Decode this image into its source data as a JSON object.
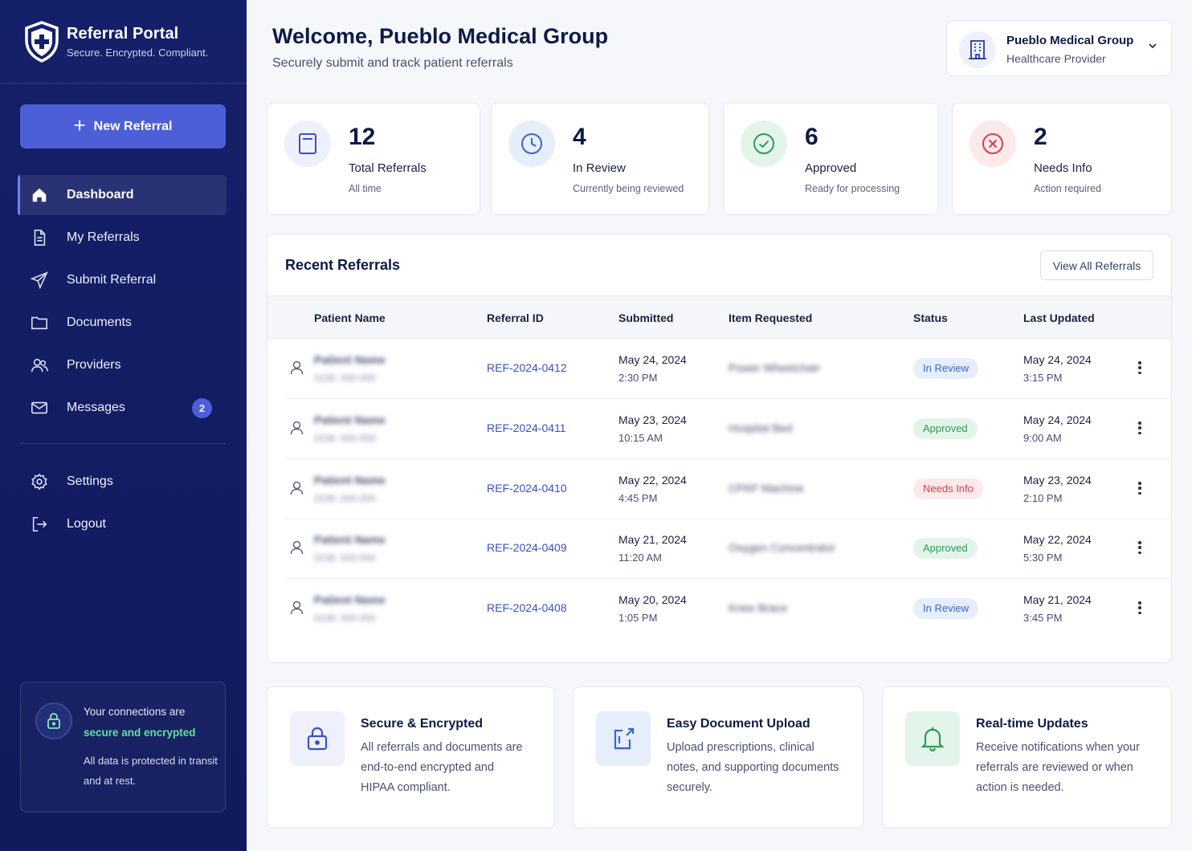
{
  "brand": {
    "title": "Referral Portal",
    "subtitle": "Secure. Encrypted. Compliant."
  },
  "sidebar": {
    "new_button": "New Referral",
    "items": [
      {
        "label": "Dashboard",
        "icon": "home-icon",
        "active": true
      },
      {
        "label": "My Referrals",
        "icon": "document-icon"
      },
      {
        "label": "Submit Referral",
        "icon": "send-icon"
      },
      {
        "label": "Documents",
        "icon": "folder-icon"
      },
      {
        "label": "Providers",
        "icon": "users-icon"
      },
      {
        "label": "Messages",
        "icon": "mail-icon",
        "badge": "2"
      }
    ],
    "secondary": [
      {
        "label": "Settings",
        "icon": "gear-icon"
      },
      {
        "label": "Logout",
        "icon": "logout-icon"
      }
    ],
    "security": {
      "line1": "Your connections are",
      "line2": "secure and encrypted",
      "note": "All data is protected in transit and at rest."
    }
  },
  "header": {
    "welcome": "Welcome, Pueblo Medical Group",
    "subtitle": "Securely submit and track patient referrals",
    "org_name": "Pueblo Medical Group",
    "org_role": "Healthcare Provider"
  },
  "stats": [
    {
      "value": "12",
      "label": "Total Referrals",
      "sub": "All time",
      "icon": "document-icon",
      "color": "#3a4fc4",
      "bg": "#eef0fb"
    },
    {
      "value": "4",
      "label": "In Review",
      "sub": "Currently being reviewed",
      "icon": "clock-icon",
      "color": "#3a64c8",
      "bg": "#e6eefb"
    },
    {
      "value": "6",
      "label": "Approved",
      "sub": "Ready for processing",
      "icon": "check-circle-icon",
      "color": "#2f9a57",
      "bg": "#e3f5ea"
    },
    {
      "value": "2",
      "label": "Needs Info",
      "sub": "Action required",
      "icon": "x-circle-icon",
      "color": "#d0434f",
      "bg": "#fde8ea"
    }
  ],
  "recent": {
    "title": "Recent Referrals",
    "view_all": "View All Referrals",
    "columns": [
      "Patient Name",
      "Referral ID",
      "Submitted",
      "Item Requested",
      "Status",
      "Last Updated"
    ],
    "rows": [
      {
        "name": "Patient Name",
        "dob": "DOB: 000-000",
        "id": "REF-2024-0412",
        "submitted_date": "May 24, 2024",
        "submitted_time": "2:30 PM",
        "item": "Power Wheelchair",
        "status": "In Review",
        "status_kind": "review",
        "updated_date": "May 24, 2024",
        "updated_time": "3:15 PM"
      },
      {
        "name": "Patient Name",
        "dob": "DOB: 000-000",
        "id": "REF-2024-0411",
        "submitted_date": "May 23, 2024",
        "submitted_time": "10:15 AM",
        "item": "Hospital Bed",
        "status": "Approved",
        "status_kind": "approved",
        "updated_date": "May 24, 2024",
        "updated_time": "9:00 AM"
      },
      {
        "name": "Patient Name",
        "dob": "DOB: 000-000",
        "id": "REF-2024-0410",
        "submitted_date": "May 22, 2024",
        "submitted_time": "4:45 PM",
        "item": "CPAP Machine",
        "status": "Needs Info",
        "status_kind": "needs",
        "updated_date": "May 23, 2024",
        "updated_time": "2:10 PM"
      },
      {
        "name": "Patient Name",
        "dob": "DOB: 000-000",
        "id": "REF-2024-0409",
        "submitted_date": "May 21, 2024",
        "submitted_time": "11:20 AM",
        "item": "Oxygen Concentrator",
        "status": "Approved",
        "status_kind": "approved",
        "updated_date": "May 22, 2024",
        "updated_time": "5:30 PM"
      },
      {
        "name": "Patient Name",
        "dob": "DOB: 000-000",
        "id": "REF-2024-0408",
        "submitted_date": "May 20, 2024",
        "submitted_time": "1:05 PM",
        "item": "Knee Brace",
        "status": "In Review",
        "status_kind": "review",
        "updated_date": "May 21, 2024",
        "updated_time": "3:45 PM"
      }
    ]
  },
  "features": [
    {
      "title": "Secure & Encrypted",
      "desc": [
        "All referrals and documents are",
        "end-to-end encrypted and",
        "HIPAA compliant."
      ],
      "icon": "lock-icon",
      "color": "#3a4fc4",
      "bg": "#eef0fb"
    },
    {
      "title": "Easy Document Upload",
      "desc": [
        "Upload prescriptions, clinical",
        "notes, and supporting documents",
        "securely."
      ],
      "icon": "upload-icon",
      "color": "#3a64c8",
      "bg": "#e6eefb"
    },
    {
      "title": "Real-time Updates",
      "desc": [
        "Receive notifications when your",
        "referrals are reviewed or when",
        "action is needed."
      ],
      "icon": "bell-icon",
      "color": "#2f9a57",
      "bg": "#e3f5ea"
    }
  ]
}
